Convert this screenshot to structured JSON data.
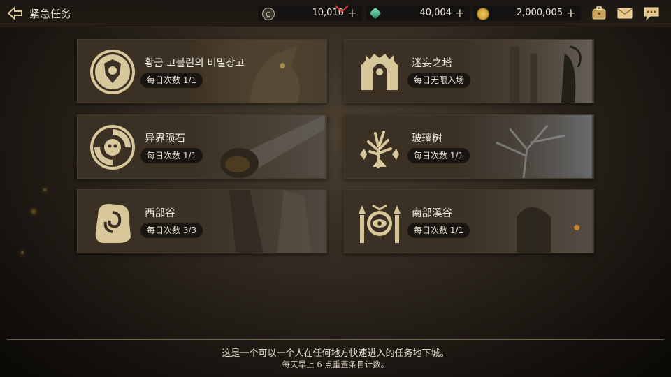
{
  "header": {
    "title": "紧急任务",
    "currencies": [
      {
        "icon": "silver-coin-icon",
        "value": "10,010"
      },
      {
        "icon": "green-gem-icon",
        "value": "40,004"
      },
      {
        "icon": "gold-coin-icon",
        "value": "2,000,005"
      }
    ],
    "plus_label": "+",
    "icons": [
      "bag-icon",
      "mail-icon",
      "chat-icon"
    ]
  },
  "dungeons": [
    {
      "name": "황금 고블린의 비밀창고",
      "badge": "每日次数 1/1",
      "emblem": "goblin-crest-icon"
    },
    {
      "name": "迷妄之塔",
      "badge": "每日无限入场",
      "emblem": "tower-hooded-icon"
    },
    {
      "name": "异界陨石",
      "badge": "每日次数 1/1",
      "emblem": "meteor-swirl-icon"
    },
    {
      "name": "玻璃树",
      "badge": "每日次数 1/1",
      "emblem": "tree-icon"
    },
    {
      "name": "西部谷",
      "badge": "每日次数 3/3",
      "emblem": "rune-stone-icon"
    },
    {
      "name": "南部溪谷",
      "badge": "每日次数 1/1",
      "emblem": "eye-gate-icon"
    }
  ],
  "footer": {
    "line1": "这是一个可以一个人在任何地方快速进入的任务地下城。",
    "line2": "每天早上 6 点重置条目计数。"
  },
  "colors": {
    "gold": "#d8c79a",
    "card_bg": "#3a3023",
    "text": "#e9e2cf"
  }
}
